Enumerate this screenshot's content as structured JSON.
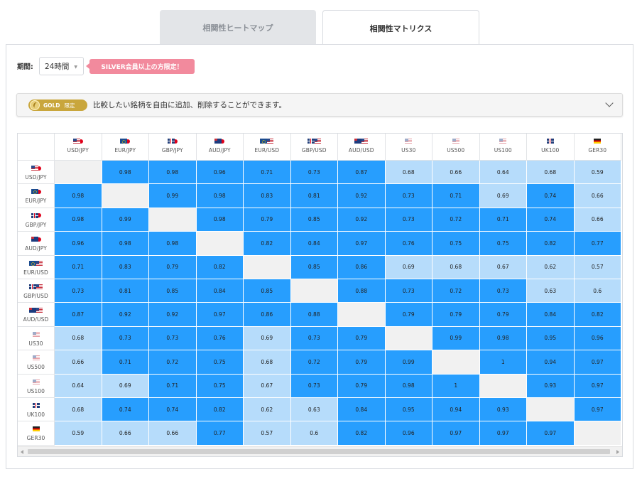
{
  "tabs": [
    {
      "label": "相関性ヒートマップ",
      "active": false
    },
    {
      "label": "相関性マトリクス",
      "active": true
    }
  ],
  "filters": {
    "period_label": "期間:",
    "period_value": "24時間",
    "silver_notice": "SILVER会員以上の方限定！"
  },
  "gold_bar": {
    "badge_label": "GOLD",
    "badge_sub": "限定",
    "text": "比較したい銘柄を自由に追加、削除することができます。"
  },
  "colors": {
    "high": "#279efe",
    "low": "#b6dcfb",
    "self": "#f1f1f1",
    "threshold": 0.7
  },
  "matrix": {
    "symbols": [
      {
        "name": "USD/JPY",
        "flags": [
          "us",
          "jp"
        ]
      },
      {
        "name": "EUR/JPY",
        "flags": [
          "eu",
          "jp"
        ]
      },
      {
        "name": "GBP/JPY",
        "flags": [
          "uk",
          "jp"
        ]
      },
      {
        "name": "AUD/JPY",
        "flags": [
          "au",
          "jp"
        ]
      },
      {
        "name": "EUR/USD",
        "flags": [
          "eu",
          "us"
        ]
      },
      {
        "name": "GBP/USD",
        "flags": [
          "uk",
          "us"
        ]
      },
      {
        "name": "AUD/USD",
        "flags": [
          "au",
          "us"
        ]
      },
      {
        "name": "US30",
        "flags": [
          "us"
        ]
      },
      {
        "name": "US500",
        "flags": [
          "us"
        ]
      },
      {
        "name": "US100",
        "flags": [
          "us"
        ]
      },
      {
        "name": "UK100",
        "flags": [
          "uk"
        ]
      },
      {
        "name": "GER30",
        "flags": [
          "de"
        ]
      }
    ],
    "values": [
      [
        null,
        "0.98",
        "0.98",
        "0.96",
        "0.71",
        "0.73",
        "0.87",
        "0.68",
        "0.66",
        "0.64",
        "0.68",
        "0.59"
      ],
      [
        "0.98",
        null,
        "0.99",
        "0.98",
        "0.83",
        "0.81",
        "0.92",
        "0.73",
        "0.71",
        "0.69",
        "0.74",
        "0.66"
      ],
      [
        "0.98",
        "0.99",
        null,
        "0.98",
        "0.79",
        "0.85",
        "0.92",
        "0.73",
        "0.72",
        "0.71",
        "0.74",
        "0.66"
      ],
      [
        "0.96",
        "0.98",
        "0.98",
        null,
        "0.82",
        "0.84",
        "0.97",
        "0.76",
        "0.75",
        "0.75",
        "0.82",
        "0.77"
      ],
      [
        "0.71",
        "0.83",
        "0.79",
        "0.82",
        null,
        "0.85",
        "0.86",
        "0.69",
        "0.68",
        "0.67",
        "0.62",
        "0.57"
      ],
      [
        "0.73",
        "0.81",
        "0.85",
        "0.84",
        "0.85",
        null,
        "0.88",
        "0.73",
        "0.72",
        "0.73",
        "0.63",
        "0.6"
      ],
      [
        "0.87",
        "0.92",
        "0.92",
        "0.97",
        "0.86",
        "0.88",
        null,
        "0.79",
        "0.79",
        "0.79",
        "0.84",
        "0.82"
      ],
      [
        "0.68",
        "0.73",
        "0.73",
        "0.76",
        "0.69",
        "0.73",
        "0.79",
        null,
        "0.99",
        "0.98",
        "0.95",
        "0.96"
      ],
      [
        "0.66",
        "0.71",
        "0.72",
        "0.75",
        "0.68",
        "0.72",
        "0.79",
        "0.99",
        null,
        "1",
        "0.94",
        "0.97"
      ],
      [
        "0.64",
        "0.69",
        "0.71",
        "0.75",
        "0.67",
        "0.73",
        "0.79",
        "0.98",
        "1",
        null,
        "0.93",
        "0.97"
      ],
      [
        "0.68",
        "0.74",
        "0.74",
        "0.82",
        "0.62",
        "0.63",
        "0.84",
        "0.95",
        "0.94",
        "0.93",
        null,
        "0.97"
      ],
      [
        "0.59",
        "0.66",
        "0.66",
        "0.77",
        "0.57",
        "0.6",
        "0.82",
        "0.96",
        "0.97",
        "0.97",
        "0.97",
        null
      ]
    ]
  }
}
